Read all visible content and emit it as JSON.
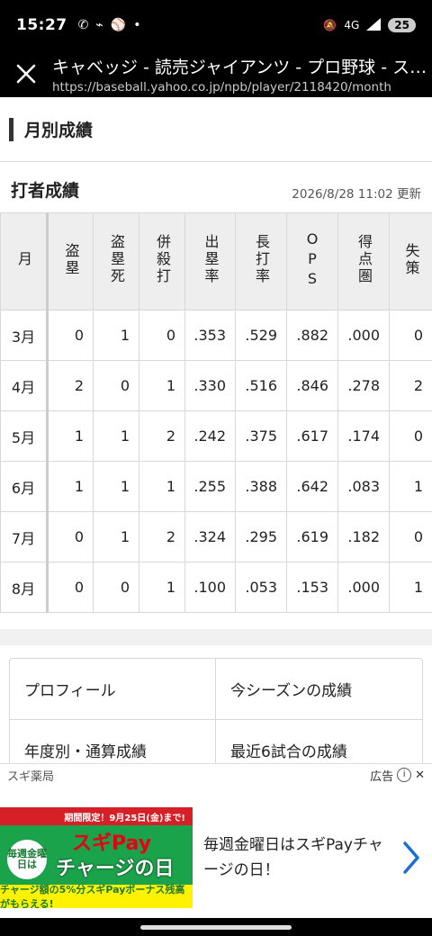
{
  "status_bar": {
    "time": "15:27",
    "network": "4G",
    "battery": "25",
    "icons": [
      "missed-call-icon",
      "voicemail-icon",
      "baseball-icon",
      "dot-icon",
      "mute-icon",
      "signal-icon"
    ]
  },
  "app_bar": {
    "title": "キャベッジ - 読売ジャイアンツ - プロ野球 - スポーツナビ",
    "url": "https://baseball.yahoo.co.jp/npb/player/2118420/month"
  },
  "section": {
    "title": "月別成績"
  },
  "batting": {
    "title": "打者成績",
    "updated": "2026/8/28 11:02 更新",
    "columns": [
      "月",
      "盗塁",
      "盗塁死",
      "併殺打",
      "出塁率",
      "長打率",
      "OPS",
      "得点圏",
      "失策"
    ],
    "rows": [
      [
        "3月",
        "0",
        "1",
        "0",
        ".353",
        ".529",
        ".882",
        ".000",
        "0"
      ],
      [
        "4月",
        "2",
        "0",
        "1",
        ".330",
        ".516",
        ".846",
        ".278",
        "2"
      ],
      [
        "5月",
        "1",
        "1",
        "2",
        ".242",
        ".375",
        ".617",
        ".174",
        "0"
      ],
      [
        "6月",
        "1",
        "1",
        "1",
        ".255",
        ".388",
        ".642",
        ".083",
        "1"
      ],
      [
        "7月",
        "0",
        "1",
        "2",
        ".324",
        ".295",
        ".619",
        ".182",
        "0"
      ],
      [
        "8月",
        "0",
        "0",
        "1",
        ".100",
        ".053",
        ".153",
        ".000",
        "1"
      ]
    ]
  },
  "links": [
    {
      "label": "プロフィール"
    },
    {
      "label": "今シーズンの成績"
    },
    {
      "label": "年度別・通算成績"
    },
    {
      "label": "最近6試合の成績"
    }
  ],
  "ad": {
    "advertiser": "スギ薬局",
    "label": "広告",
    "text": "毎週金曜日はスギPayチャージの日！",
    "banner_period": "期間限定！9月25日(金)まで!",
    "banner_brand_1": "スギPay",
    "banner_brand_2": "チャージの日",
    "banner_circle": "毎週金曜日は",
    "banner_bottom": "チャージ額の5%分スギPayボーナス残高がもらえる!"
  }
}
